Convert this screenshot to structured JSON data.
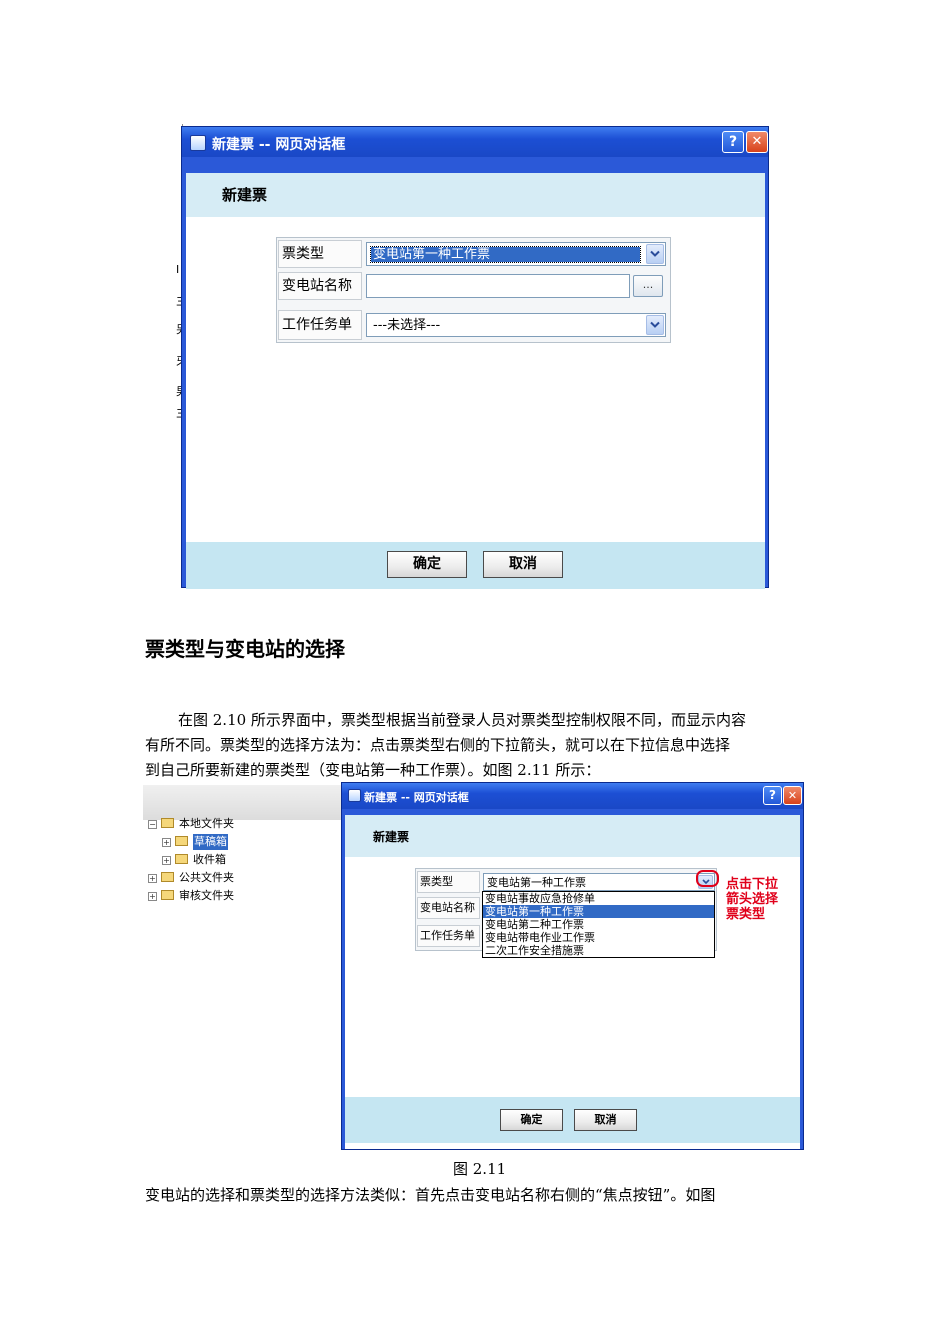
{
  "figure1": {
    "window_title": "新建票 -- 网页对话框",
    "help_label": "?",
    "close_label": "✕",
    "panel_title": "新建票",
    "rows": [
      {
        "label": "票类型",
        "value": "变电站第一种工作票"
      },
      {
        "label": "变电站名称",
        "value": ""
      },
      {
        "label": "工作任务单",
        "value": "---未选择---"
      }
    ],
    "browse_label": "...",
    "ok_label": "确定",
    "cancel_label": "取消",
    "left_strip_chars": [
      "I",
      "三",
      "另",
      "牙",
      "男",
      "三"
    ]
  },
  "section_heading": "票类型与变电站的选择",
  "paragraph_lines": [
    "在图 2.10 所示界面中，票类型根据当前登录人员对票类型控制权限不同，而显示内容",
    "有所不同。票类型的选择方法为：点击票类型右侧的下拉箭头，就可以在下拉信息中选择",
    "到自己所要新建的票类型（变电站第一种工作票）。如图 2.11 所示："
  ],
  "figure2": {
    "tree": [
      {
        "label": "本地文件夹",
        "toggle": "−"
      },
      {
        "label": "草稿箱",
        "toggle": "+"
      },
      {
        "label": "收件箱",
        "toggle": "+"
      },
      {
        "label": "公共文件夹",
        "toggle": "+"
      },
      {
        "label": "审核文件夹",
        "toggle": "+"
      }
    ],
    "window_title": "新建票 -- 网页对话框",
    "help_label": "?",
    "close_label": "✕",
    "panel_title": "新建票",
    "row_labels": [
      "票类型",
      "变电站名称",
      "工作任务单"
    ],
    "selected_value": "变电站第一种工作票",
    "dropdown_options": [
      "变电站事故应急抢修单",
      "变电站第一种工作票",
      "变电站第二种工作票",
      "变电站带电作业工作票",
      "二次工作安全措施票"
    ],
    "dropdown_selected_index": 1,
    "callout_lines": [
      "点击下拉",
      "箭头选择",
      "票类型"
    ],
    "ok_label": "确定",
    "cancel_label": "取消",
    "caption": "图 2.11"
  },
  "closing_line": "变电站的选择和票类型的选择方法类似：首先点击变电站名称右侧的“焦点按钮”。如图",
  "colors": {
    "title_bar": "#1c4fd4",
    "panel_header": "#d6ecf5",
    "selection": "#316ac5",
    "callout": "#e0001a"
  }
}
